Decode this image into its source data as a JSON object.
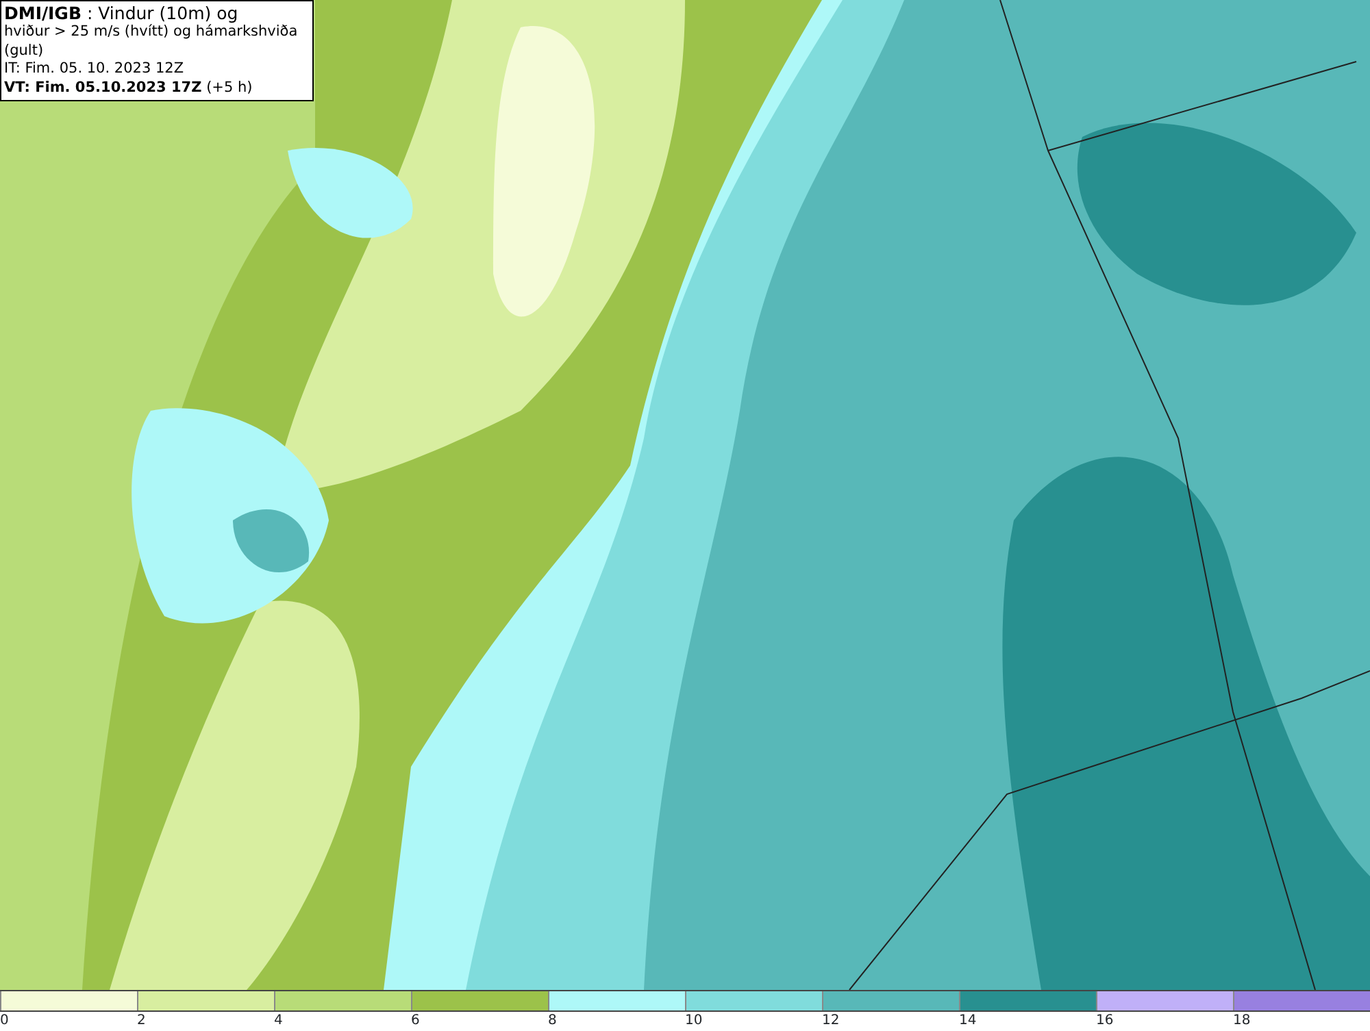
{
  "title_box": {
    "lines": [
      "**DMI/IGB** : Vindur (10m) og",
      "hviður > 25 m/s (hvítt) og hámarkshviða (gult)",
      "IT: Fim. 05. 10. 2023 12Z",
      "**VT: Fim. 05.10.2023 17Z** (+5 h)"
    ]
  },
  "legend": {
    "segments": [
      {
        "label": "0",
        "color": "#f5fbd8"
      },
      {
        "label": "2",
        "color": "#d8eea0"
      },
      {
        "label": "4",
        "color": "#b8dc78"
      },
      {
        "label": "6",
        "color": "#9cc24a"
      },
      {
        "label": "8",
        "color": "#aef8f8"
      },
      {
        "label": "10",
        "color": "#80dcdc"
      },
      {
        "label": "12",
        "color": "#58b8b8"
      },
      {
        "label": "14",
        "color": "#289090"
      },
      {
        "label": "16",
        "color": "#c0b0f8"
      },
      {
        "label": "18",
        "color": "#9880e0"
      }
    ]
  }
}
